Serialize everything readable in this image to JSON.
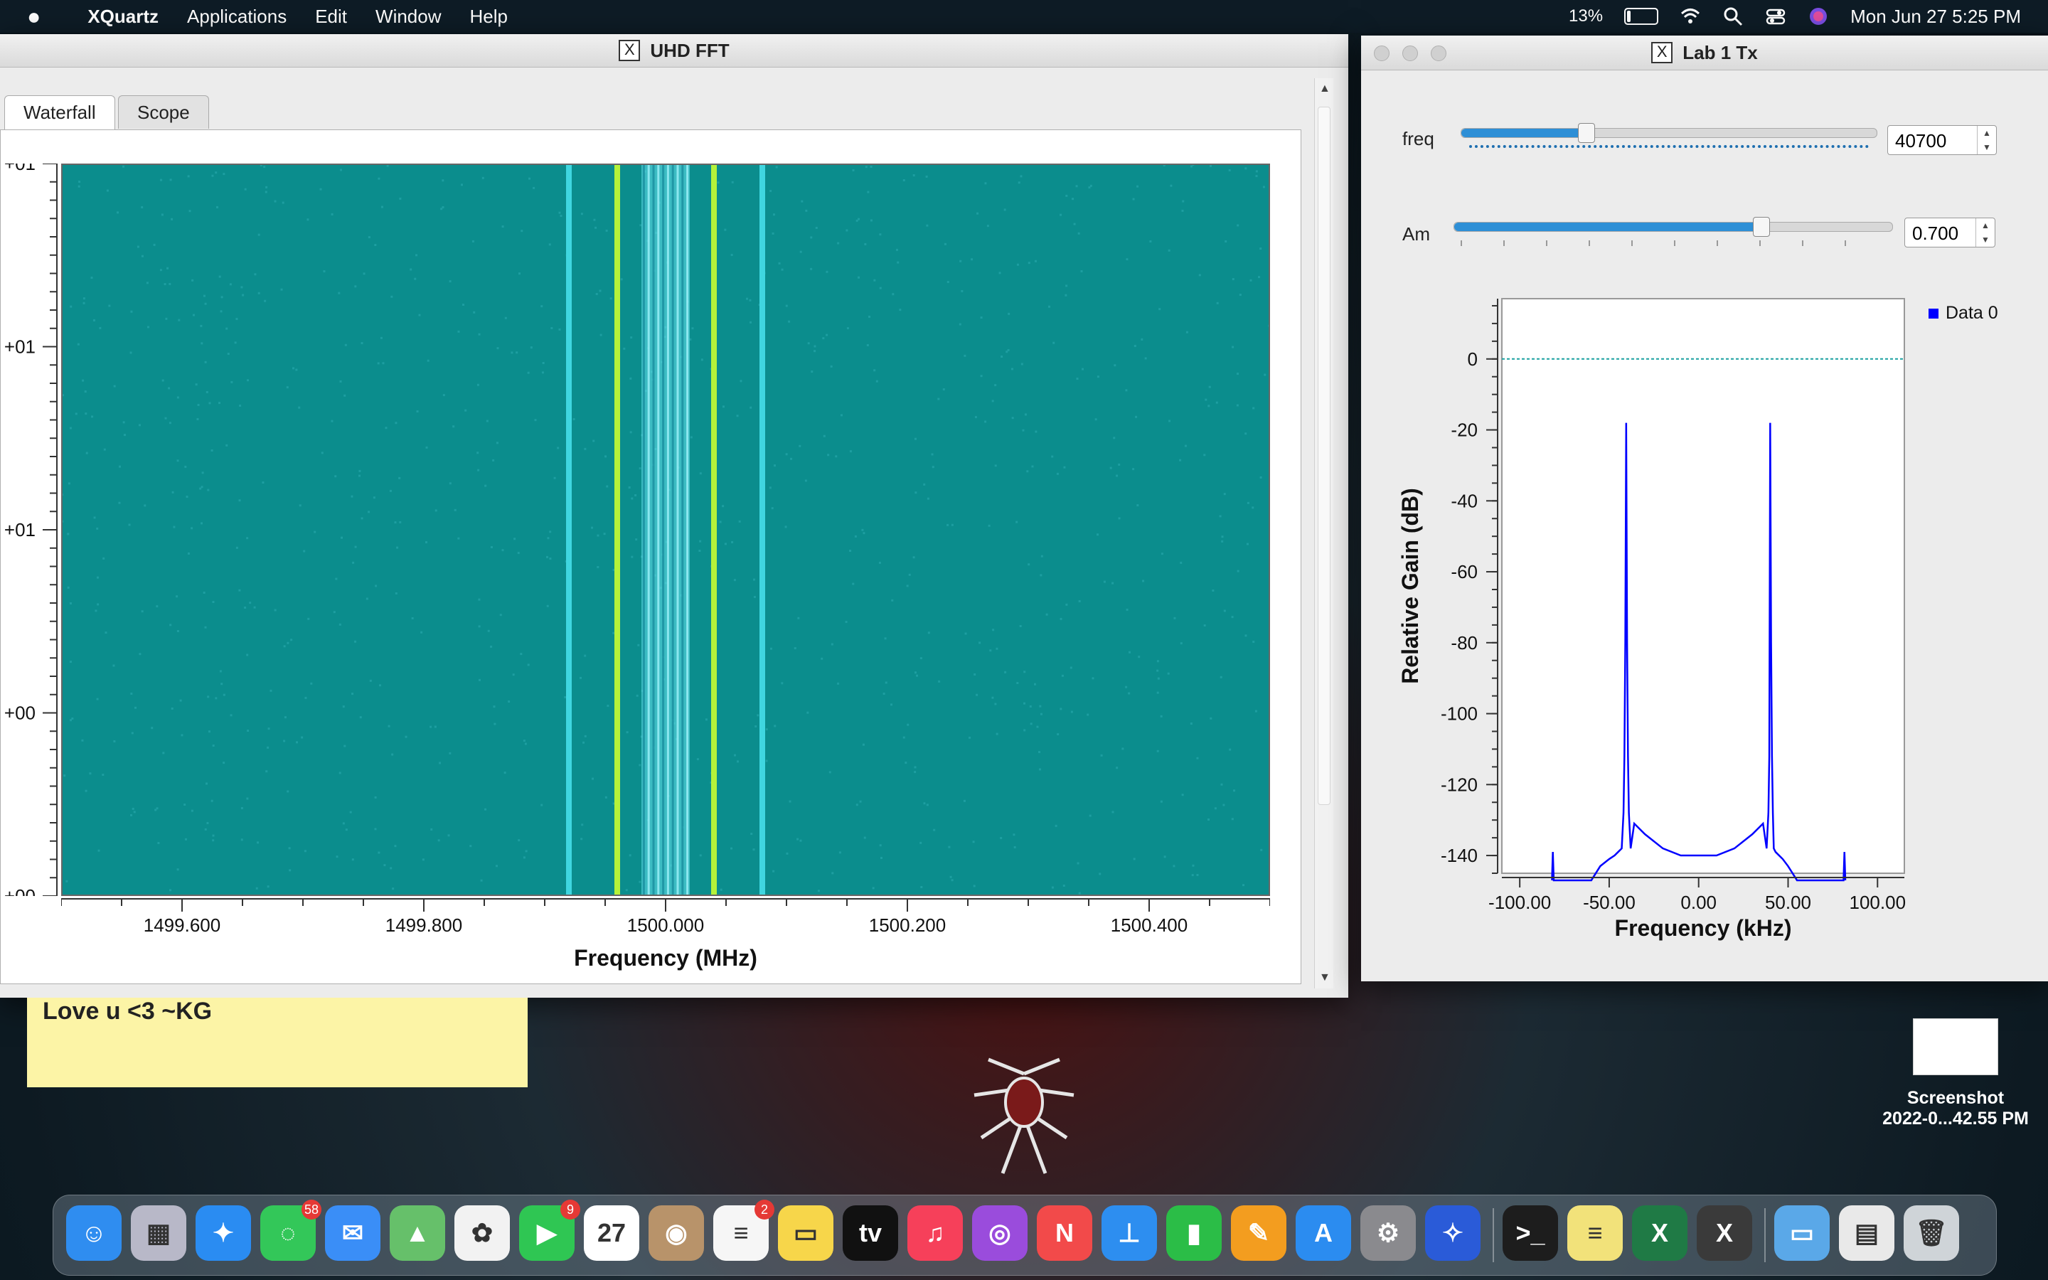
{
  "menubar": {
    "app": "XQuartz",
    "items": [
      "Applications",
      "Edit",
      "Window",
      "Help"
    ],
    "battery": "13%",
    "datetime": "Mon Jun 27  5:25 PM"
  },
  "fft_window": {
    "title": "UHD FFT",
    "tabs": [
      "Waterfall",
      "Scope"
    ],
    "y_ticks": [
      "+01",
      "+01",
      "+01",
      "+00",
      "+00"
    ],
    "chart_data": {
      "type": "heatmap",
      "xlabel": "Frequency (MHz)",
      "x_ticks": [
        "1499.600",
        "1499.800",
        "1500.000",
        "1500.200",
        "1500.400"
      ],
      "xlim": [
        1499.5,
        1500.5
      ],
      "colors": {
        "background": "#0b8d8d",
        "lines_cyan": "#3fd6e0",
        "lines_green": "#b5f23a",
        "band": "#66e3f0"
      },
      "vertical_lines_mhz": [
        {
          "x": 1499.92,
          "color": "cyan"
        },
        {
          "x": 1499.96,
          "color": "green"
        },
        {
          "x": 1500.04,
          "color": "green"
        },
        {
          "x": 1500.08,
          "color": "cyan"
        }
      ],
      "band_mhz": [
        1499.98,
        1500.02
      ]
    }
  },
  "lab_window": {
    "title": "Lab 1 Tx",
    "freq": {
      "label": "freq",
      "value": "40700",
      "position": 0.3
    },
    "am": {
      "label": "Am",
      "value": "0.700",
      "position": 0.7
    },
    "chart_data": {
      "type": "line",
      "xlabel": "Frequency (kHz)",
      "ylabel": "Relative Gain (dB)",
      "legend": "Data 0",
      "legend_position": "top-right",
      "xlim": [
        -110,
        115
      ],
      "ylim": [
        -145,
        17
      ],
      "x_ticks": [
        -100,
        -50,
        0,
        50,
        100
      ],
      "x_tick_labels": [
        "-100.00",
        "-50.00",
        "0.00",
        "50.00",
        "100.00"
      ],
      "y_ticks": [
        0,
        -20,
        -40,
        -60,
        -80,
        -100,
        -120,
        -140
      ],
      "series": [
        {
          "color": "#0000ff",
          "x": [
            -82,
            -81.5,
            -81,
            -60,
            -55,
            -50,
            -47,
            -45,
            -43,
            -42,
            -41.5,
            -41,
            -40.5,
            -40,
            -39.5,
            -39,
            -38,
            -36,
            -30,
            -20,
            -10,
            0,
            10,
            20,
            30,
            36,
            38,
            39,
            39.5,
            40,
            40.5,
            41,
            41.5,
            42,
            43,
            45,
            47,
            50,
            55,
            60,
            81,
            81.5,
            82
          ],
          "y": [
            -147,
            -139,
            -147,
            -147,
            -143,
            -141,
            -140,
            -139,
            -138,
            -128,
            -112,
            -80,
            -18,
            -80,
            -112,
            -128,
            -138,
            -131,
            -134,
            -138,
            -140,
            -140,
            -140,
            -138,
            -134,
            -131,
            -138,
            -128,
            -112,
            -18,
            -80,
            -112,
            -128,
            -138,
            -139,
            -140,
            -141,
            -143,
            -147,
            -147,
            -147,
            -139,
            -147
          ]
        },
        {
          "color": "#1aa0a0",
          "x": [
            -110,
            115
          ],
          "y": [
            0,
            0
          ]
        }
      ]
    }
  },
  "sticky_note": {
    "text": "Love u <3 ~KG"
  },
  "desktop_file": {
    "name": "Screenshot",
    "subtitle": "2022-0...42.55 PM"
  },
  "dock": {
    "apps": [
      {
        "name": "finder",
        "color": "#2f8df0",
        "glyph": "☺"
      },
      {
        "name": "launchpad",
        "color": "#b8b8c8",
        "glyph": "▦"
      },
      {
        "name": "safari",
        "color": "#2a8cf2",
        "glyph": "✦"
      },
      {
        "name": "messages",
        "color": "#33c759",
        "glyph": "◌",
        "badge": "58"
      },
      {
        "name": "mail",
        "color": "#3a8ef7",
        "glyph": "✉"
      },
      {
        "name": "maps",
        "color": "#66c06a",
        "glyph": "▲"
      },
      {
        "name": "photos",
        "color": "#f2f2f2",
        "glyph": "✿"
      },
      {
        "name": "facetime",
        "color": "#2fc653",
        "glyph": "▶",
        "badge": "9"
      },
      {
        "name": "calendar",
        "color": "#ffffff",
        "glyph": "27"
      },
      {
        "name": "contacts",
        "color": "#b8936a",
        "glyph": "◉"
      },
      {
        "name": "reminders",
        "color": "#f6f6f6",
        "glyph": "≡",
        "badge": "2"
      },
      {
        "name": "notes",
        "color": "#f7d64a",
        "glyph": "▭"
      },
      {
        "name": "tv",
        "color": "#111111",
        "glyph": "tv"
      },
      {
        "name": "music",
        "color": "#f6405a",
        "glyph": "♫"
      },
      {
        "name": "podcasts",
        "color": "#9a4cdc",
        "glyph": "◎"
      },
      {
        "name": "news",
        "color": "#f24a4a",
        "glyph": "N"
      },
      {
        "name": "keynote",
        "color": "#2d8ef0",
        "glyph": "⊥"
      },
      {
        "name": "numbers",
        "color": "#2bbd47",
        "glyph": "▮"
      },
      {
        "name": "pages",
        "color": "#f39d1f",
        "glyph": "✎"
      },
      {
        "name": "app-store",
        "color": "#2b8cf0",
        "glyph": "A"
      },
      {
        "name": "system-preferences",
        "color": "#8a8a8e",
        "glyph": "⚙"
      },
      {
        "name": "xcode-game",
        "color": "#2a5bd8",
        "glyph": "✧"
      },
      {
        "name": "terminal",
        "color": "#1d1d1d",
        "glyph": ">_"
      },
      {
        "name": "stickies",
        "color": "#f2e27a",
        "glyph": "≡"
      },
      {
        "name": "excel",
        "color": "#1f7a45",
        "glyph": "X"
      },
      {
        "name": "xquartz",
        "color": "#3a3a3a",
        "glyph": "X"
      },
      {
        "name": "folder",
        "color": "#5aa8e8",
        "glyph": "▭"
      },
      {
        "name": "screenshots-stack",
        "color": "#e9e9e9",
        "glyph": "▤"
      },
      {
        "name": "trash",
        "color": "#cfd4d8",
        "glyph": "🗑"
      }
    ]
  }
}
